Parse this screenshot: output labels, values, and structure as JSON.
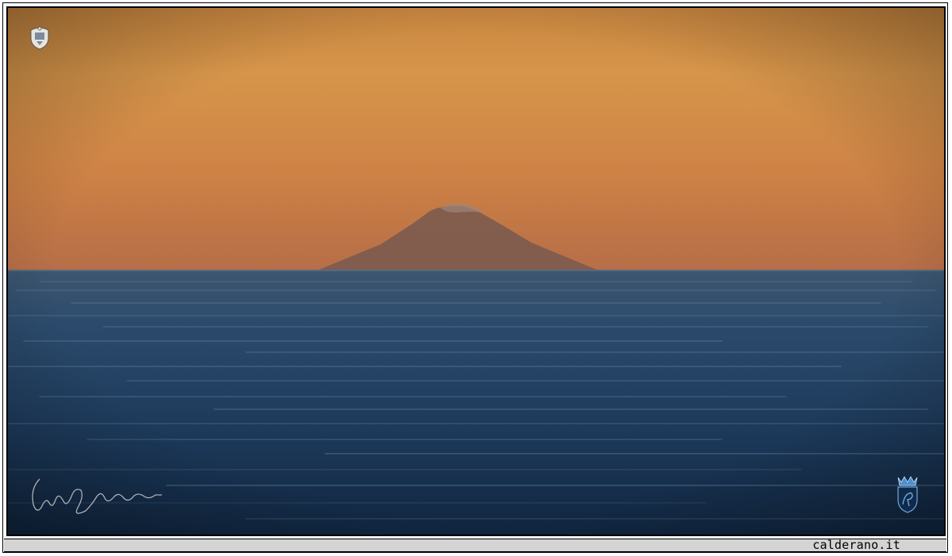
{
  "caption": {
    "site": "calderano.it"
  },
  "image": {
    "sky_top_color": "#d2934a",
    "sky_horizon_color": "#c47a40",
    "sea_color": "#1f3c5c",
    "volcano_color": "#7e5848"
  },
  "watermarks": {
    "top_left": "crest-icon",
    "bottom_left": "signature",
    "bottom_right": "lion-crest-icon"
  }
}
